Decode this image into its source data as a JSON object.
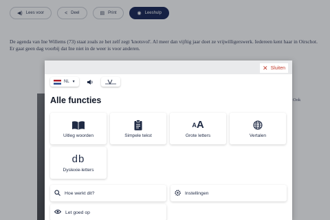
{
  "page": {
    "toolbar": {
      "items": [
        {
          "label": "Lees voor",
          "icon": "speaker-icon",
          "active": false
        },
        {
          "label": "Deel",
          "icon": "share-icon",
          "active": false
        },
        {
          "label": "Print",
          "icon": "printer-icon",
          "active": false
        },
        {
          "label": "Leeshulp",
          "icon": "reading-aid-icon",
          "active": true
        }
      ]
    },
    "article_text": "De agenda van Ine Willems (73) staat zoals ze het zelf zegt 'knotsvol'. Al meer dan vijftig jaar doet ze vrijwilligerswerk. Iedereen kent haar in Oirschot. Er gaat geen dag voorbij dat Ine niet in de weer is voor anderen.",
    "side_text": [
      "Ook"
    ]
  },
  "modal": {
    "close_label": "Sluiten",
    "language": {
      "code": "NL",
      "flag": "dutch-flag-icon"
    },
    "title": "Alle functies",
    "features": [
      {
        "label": "Uitleg woorden",
        "icon": "book-icon"
      },
      {
        "label": "Simpele tekst",
        "icon": "clipboard-icon"
      },
      {
        "label": "Grote letters",
        "icon": "font-size-icon"
      },
      {
        "label": "Vertalen",
        "icon": "globe-icon"
      },
      {
        "label": "Dyslexie-letters",
        "icon": "dyslexia-font-icon",
        "glyph": "db"
      }
    ],
    "links": [
      {
        "label": "Hoe werkt dit?",
        "icon": "search-icon"
      },
      {
        "label": "Instellingen",
        "icon": "gear-icon"
      },
      {
        "label": "Let goed op",
        "icon": "eye-icon"
      }
    ],
    "font_size_glyph": "AA"
  },
  "colors": {
    "navy": "#0c1a4e",
    "close_red": "#c0392b",
    "overlay": "rgba(40,44,52,0.38)"
  }
}
